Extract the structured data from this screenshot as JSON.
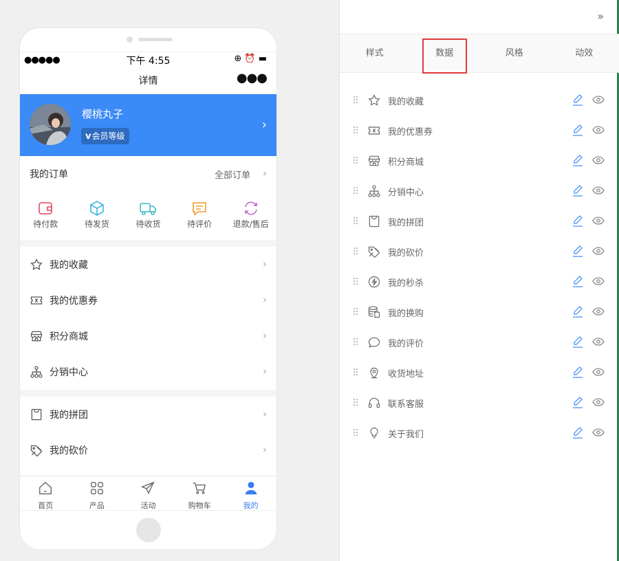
{
  "phone": {
    "status": {
      "signal": "●●●●●",
      "time": "下午 4:55",
      "icons": "⊕ ⏰ ▬"
    },
    "nav": {
      "title": "详情",
      "more": "●●●"
    },
    "profile": {
      "name": "樱桃丸子",
      "badge_v": "v",
      "badge_text": "会员等级"
    },
    "orders": {
      "title": "我的订单",
      "all_label": "全部订单",
      "items": [
        {
          "label": "待付款",
          "icon": "wallet-icon",
          "color": "#e8475f"
        },
        {
          "label": "待发货",
          "icon": "box-icon",
          "color": "#40b4e6"
        },
        {
          "label": "待收货",
          "icon": "truck-icon",
          "color": "#3cb9c4"
        },
        {
          "label": "待评价",
          "icon": "comment-icon",
          "color": "#f09a2a"
        },
        {
          "label": "退款/售后",
          "icon": "refund-icon",
          "color": "#c25fd6"
        }
      ]
    },
    "menu_group1": [
      {
        "label": "我的收藏",
        "icon": "star-icon"
      },
      {
        "label": "我的优惠券",
        "icon": "ticket-icon"
      },
      {
        "label": "积分商城",
        "icon": "store-icon"
      },
      {
        "label": "分销中心",
        "icon": "network-icon"
      }
    ],
    "menu_group2": [
      {
        "label": "我的拼团",
        "icon": "bag-icon"
      },
      {
        "label": "我的砍价",
        "icon": "price-tag-icon"
      }
    ],
    "tabbar": [
      {
        "label": "首页",
        "icon": "home-icon",
        "active": false
      },
      {
        "label": "产品",
        "icon": "grid-icon",
        "active": false
      },
      {
        "label": "活动",
        "icon": "paper-plane-icon",
        "active": false
      },
      {
        "label": "购物车",
        "icon": "cart-icon",
        "active": false
      },
      {
        "label": "我的",
        "icon": "user-icon",
        "active": true
      }
    ],
    "accent": "#3a8af7"
  },
  "panel": {
    "collapse_icon": "»",
    "tabs": [
      {
        "label": "样式",
        "active": false
      },
      {
        "label": "数据",
        "active": true
      },
      {
        "label": "风格",
        "active": false
      },
      {
        "label": "动效",
        "active": false
      }
    ],
    "items": [
      {
        "label": "我的收藏",
        "icon": "star-icon"
      },
      {
        "label": "我的优惠券",
        "icon": "ticket-icon"
      },
      {
        "label": "积分商城",
        "icon": "store-icon"
      },
      {
        "label": "分销中心",
        "icon": "network-icon"
      },
      {
        "label": "我的拼团",
        "icon": "bag-icon"
      },
      {
        "label": "我的砍价",
        "icon": "price-tag-icon"
      },
      {
        "label": "我的秒杀",
        "icon": "lightning-icon"
      },
      {
        "label": "我的换购",
        "icon": "coins-icon"
      },
      {
        "label": "我的评价",
        "icon": "comment-icon"
      },
      {
        "label": "收货地址",
        "icon": "location-icon"
      },
      {
        "label": "联系客服",
        "icon": "headset-icon"
      },
      {
        "label": "关于我们",
        "icon": "bulb-icon"
      }
    ],
    "highlight_color": "#e0393a"
  }
}
